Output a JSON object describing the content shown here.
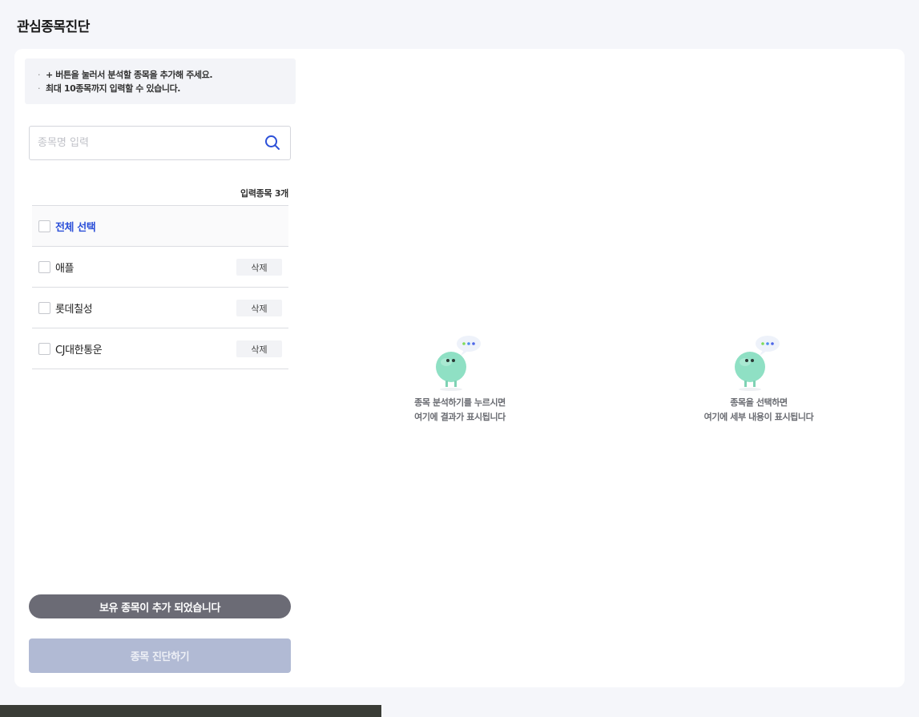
{
  "page": {
    "title": "관심종목진단"
  },
  "notice": {
    "lines": [
      "+ 버튼을 눌러서 분석할 종목을 추가해 주세요.",
      "최대 10종목까지 입력할 수 있습니다."
    ]
  },
  "search": {
    "placeholder": "종목명 입력",
    "value": ""
  },
  "list": {
    "count_label": "입력종목 3개",
    "select_all_label": "전체 선택",
    "delete_label": "삭제",
    "items": [
      {
        "name": "애플"
      },
      {
        "name": "롯데칠성"
      },
      {
        "name": "CJ대한통운"
      }
    ]
  },
  "buttons": {
    "added_notice": "보유 종목이 추가 되었습니다",
    "diagnose": "종목 진단하기"
  },
  "results_panel": {
    "line1": "종목 분석하기를 누르시면",
    "line2": "여기에 결과가 표시됩니다"
  },
  "detail_panel": {
    "line1": "종목을 선택하면",
    "line2": "여기에 세부 내용이 표시됩니다"
  },
  "colors": {
    "accent": "#2b4fd8",
    "disabled_button": "#b1bad4",
    "toast": "#6b6b75",
    "mascot": "#8fe0c4"
  }
}
